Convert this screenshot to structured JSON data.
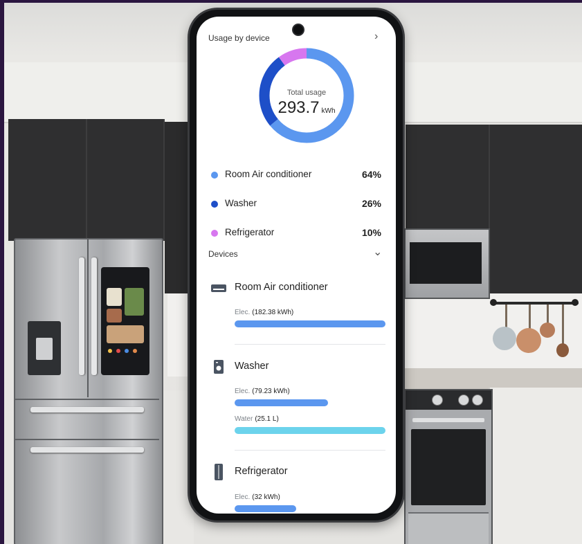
{
  "header": {
    "title": "Usage by device"
  },
  "usage": {
    "total_label": "Total usage",
    "total_value": "293.7",
    "total_unit": "kWh",
    "breakdown": [
      {
        "name": "Room Air conditioner",
        "percent": "64%",
        "fraction": 0.64,
        "color": "#5b97ef"
      },
      {
        "name": "Washer",
        "percent": "26%",
        "fraction": 0.26,
        "color": "#1e4fc8"
      },
      {
        "name": "Refrigerator",
        "percent": "10%",
        "fraction": 0.1,
        "color": "#d777ef"
      }
    ]
  },
  "devices": {
    "title": "Devices",
    "items": [
      {
        "name": "Room Air conditioner",
        "icon": "air-conditioner-icon",
        "metrics": [
          {
            "label": "Elec.",
            "value": "(182.38 kWh)",
            "fraction": 1.0,
            "color": "#5b97ef"
          }
        ]
      },
      {
        "name": "Washer",
        "icon": "washer-icon",
        "metrics": [
          {
            "label": "Elec.",
            "value": "(79.23 kWh)",
            "fraction": 0.62,
            "color": "#5b97ef"
          },
          {
            "label": "Water",
            "value": "(25.1 L)",
            "fraction": 1.0,
            "color": "#6cd3ec"
          }
        ]
      },
      {
        "name": "Refrigerator",
        "icon": "refrigerator-icon",
        "metrics": [
          {
            "label": "Elec.",
            "value": "(32 kWh)",
            "fraction": 0.41,
            "color": "#5b97ef"
          }
        ]
      }
    ]
  }
}
